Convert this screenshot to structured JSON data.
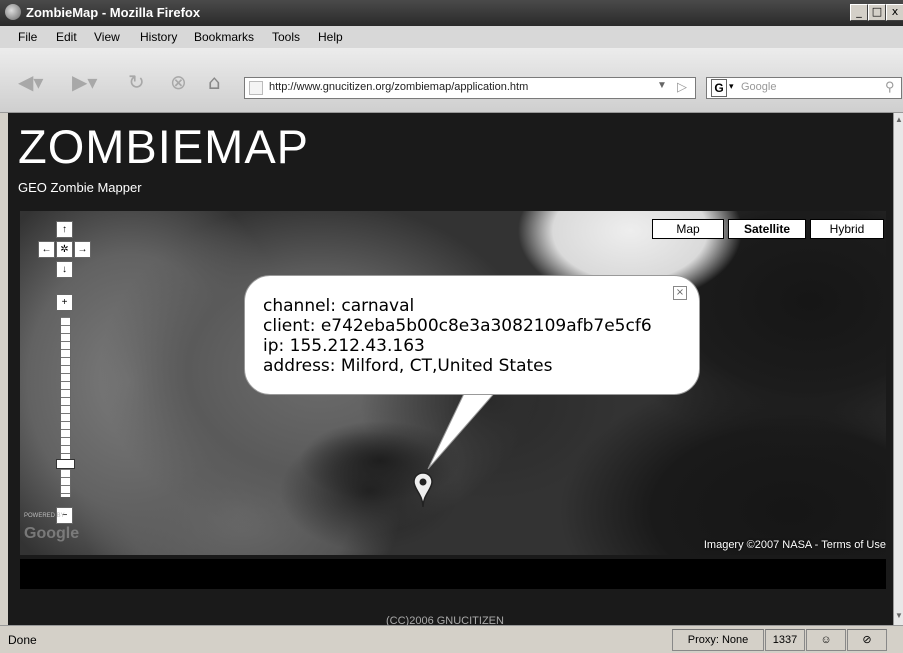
{
  "window": {
    "title": "ZombieMap - Mozilla Firefox",
    "controls": {
      "minimize": "_",
      "maximize": "□",
      "close": "x"
    }
  },
  "menubar": {
    "items": [
      {
        "label": "File"
      },
      {
        "label": "Edit"
      },
      {
        "label": "View"
      },
      {
        "label": "History"
      },
      {
        "label": "Bookmarks"
      },
      {
        "label": "Tools"
      },
      {
        "label": "Help"
      }
    ]
  },
  "toolbar": {
    "icons": [
      "back-icon",
      "forward-icon",
      "reload-icon",
      "stop-icon",
      "home-icon"
    ],
    "url": "http://www.gnucitizen.org/zombiemap/application.htm",
    "search_engine": "G",
    "search_placeholder": "Google"
  },
  "page": {
    "title": "ZOMBIEMAP",
    "subtitle": "GEO Zombie Mapper",
    "credit": "(CC)2006 GNUCITIZEN"
  },
  "map": {
    "types": [
      {
        "label": "Map",
        "active": false
      },
      {
        "label": "Satellite",
        "active": true
      },
      {
        "label": "Hybrid",
        "active": false
      }
    ],
    "pan": {
      "up": "↑",
      "left": "←",
      "center": "✲",
      "right": "→",
      "down": "↓"
    },
    "zoom": {
      "in": "+",
      "out": "−",
      "level_fraction": 0.81
    },
    "powered_by": "POWERED BY",
    "logo": "Google",
    "attribution": "Imagery ©2007 NASA - Terms of Use",
    "infowindow": {
      "channel": "channel: carnaval",
      "client": "client: e742eba5b00c8e3a3082109afb7e5cf6",
      "ip": "ip: 155.212.43.163",
      "address": "address: Milford, CT,United States",
      "close": "×"
    }
  },
  "statusbar": {
    "status": "Done",
    "proxy": "Proxy: None",
    "code": "1337"
  }
}
